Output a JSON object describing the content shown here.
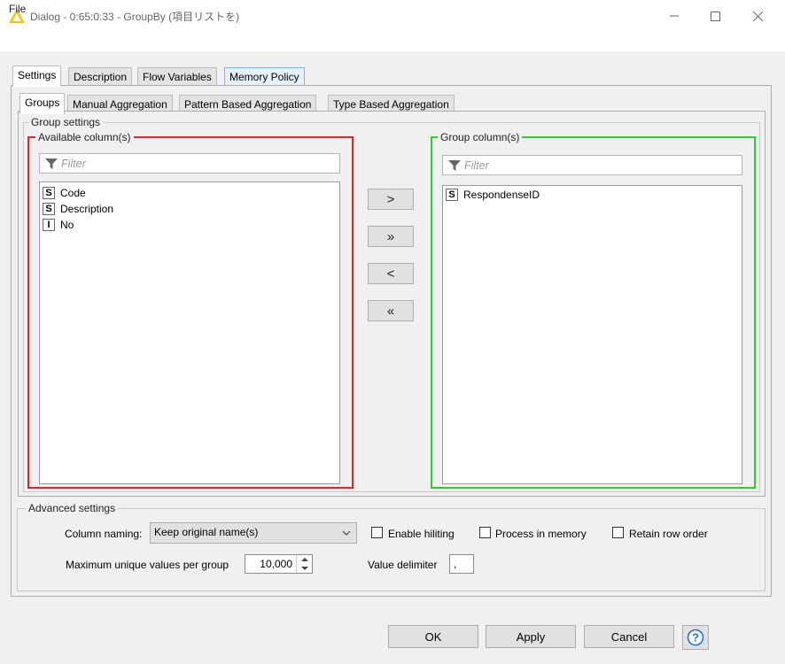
{
  "window": {
    "title": "Dialog - 0:65:0:33 - GroupBy (項目リストを)",
    "menu": [
      "File"
    ]
  },
  "outer_tabs": [
    {
      "label": "Settings",
      "active": true
    },
    {
      "label": "Description",
      "active": false
    },
    {
      "label": "Flow Variables",
      "active": false
    },
    {
      "label": "Memory Policy",
      "active": false
    }
  ],
  "inner_tabs": [
    {
      "label": "Groups",
      "active": true
    },
    {
      "label": "Manual Aggregation",
      "active": false
    },
    {
      "label": "Pattern Based Aggregation",
      "active": false
    },
    {
      "label": "Type Based Aggregation",
      "active": false
    }
  ],
  "group_settings": {
    "legend": "Group settings",
    "available": {
      "legend": "Available column(s)",
      "filter_placeholder": "Filter",
      "items": [
        {
          "type": "S",
          "name": "Code"
        },
        {
          "type": "S",
          "name": "Description"
        },
        {
          "type": "I",
          "name": "No"
        }
      ]
    },
    "move_buttons": [
      ">",
      "»",
      "<",
      "«"
    ],
    "group": {
      "legend": "Group column(s)",
      "filter_placeholder": "Filter",
      "items": [
        {
          "type": "S",
          "name": "RespondenseID"
        }
      ]
    }
  },
  "advanced": {
    "legend": "Advanced settings",
    "column_naming_label": "Column naming:",
    "column_naming_value": "Keep original name(s)",
    "enable_hiliting": "Enable hiliting",
    "process_in_memory": "Process in memory",
    "retain_row_order": "Retain row order",
    "max_unique_label": "Maximum unique values per group",
    "max_unique_value": "10,000",
    "value_delimiter_label": "Value delimiter",
    "value_delimiter": ","
  },
  "buttons": {
    "ok": "OK",
    "apply": "Apply",
    "cancel": "Cancel"
  },
  "colors": {
    "available_border": "#e32424",
    "group_border": "#2ecc2e",
    "help_icon": "#1a73e8"
  }
}
